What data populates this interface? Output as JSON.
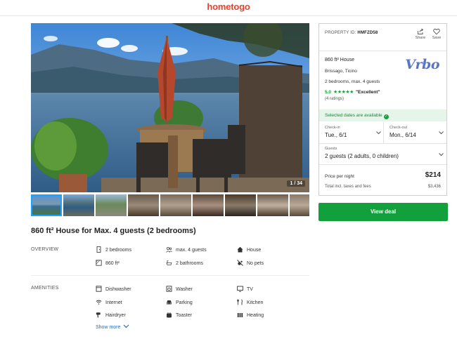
{
  "brand": {
    "logo_text": "hometogo"
  },
  "gallery": {
    "counter": "1 / 34",
    "thumbnails": [
      "thumb-lake-terrace",
      "thumb-lakeview-balcony",
      "thumb-garden-terrace",
      "thumb-living-room",
      "thumb-dining-area",
      "thumb-bedroom",
      "thumb-kitchen",
      "thumb-bathroom",
      "thumb-interior"
    ]
  },
  "listing": {
    "title": "860 ft² House for Max. 4 guests (2 bedrooms)",
    "overview": {
      "label": "OVERVIEW",
      "items": [
        {
          "icon": "door-icon",
          "text": "2 bedrooms"
        },
        {
          "icon": "guests-icon",
          "text": "max. 4 guests"
        },
        {
          "icon": "house-icon",
          "text": "House"
        },
        {
          "icon": "area-icon",
          "text": "860 ft²"
        },
        {
          "icon": "bathroom-icon",
          "text": "2 bathrooms"
        },
        {
          "icon": "no-pets-icon",
          "text": "No pets"
        }
      ]
    },
    "amenities": {
      "label": "AMENITIES",
      "items": [
        {
          "icon": "dishwasher-icon",
          "text": "Dishwasher"
        },
        {
          "icon": "washer-icon",
          "text": "Washer"
        },
        {
          "icon": "tv-icon",
          "text": "TV"
        },
        {
          "icon": "wifi-icon",
          "text": "Internet"
        },
        {
          "icon": "parking-icon",
          "text": "Parking"
        },
        {
          "icon": "kitchen-icon",
          "text": "Kitchen"
        },
        {
          "icon": "hairdryer-icon",
          "text": "Hairdryer"
        },
        {
          "icon": "toaster-icon",
          "text": "Toaster"
        },
        {
          "icon": "heating-icon",
          "text": "Heating"
        }
      ],
      "show_more": "Show more"
    }
  },
  "booking": {
    "property_id_label": "PROPERTY ID:",
    "property_id": "HMFZD58",
    "share_label": "Share",
    "save_label": "Save",
    "property_type": "860 ft² House",
    "provider": "Vrbo",
    "location": "Brissago, Ticino",
    "capacity": "2 bedrooms, max. 4 guests",
    "rating_score": "5.0",
    "rating_stars": 5,
    "rating_stars_text": "★★★★★",
    "rating_text": "\"Excellent\"",
    "rating_count": "(4 ratings)",
    "availability": "Selected dates are available",
    "checkin_label": "Check-in",
    "checkin_value": "Tue., 6/1",
    "checkout_label": "Check-out",
    "checkout_value": "Mon., 6/14",
    "guests_label": "Guests",
    "guests_value": "2 guests (2 adults, 0 children)",
    "price_label": "Price per night",
    "price_value": "$214",
    "total_label": "Total incl. taxes and fees",
    "total_value": "$3,436",
    "cta": "View deal"
  },
  "colors": {
    "brand_red": "#e8412c",
    "cta_green": "#12a03d",
    "rating_green": "#1a9e3e",
    "vrbo_blue": "#5875c8",
    "link_blue": "#1a6fc2"
  }
}
